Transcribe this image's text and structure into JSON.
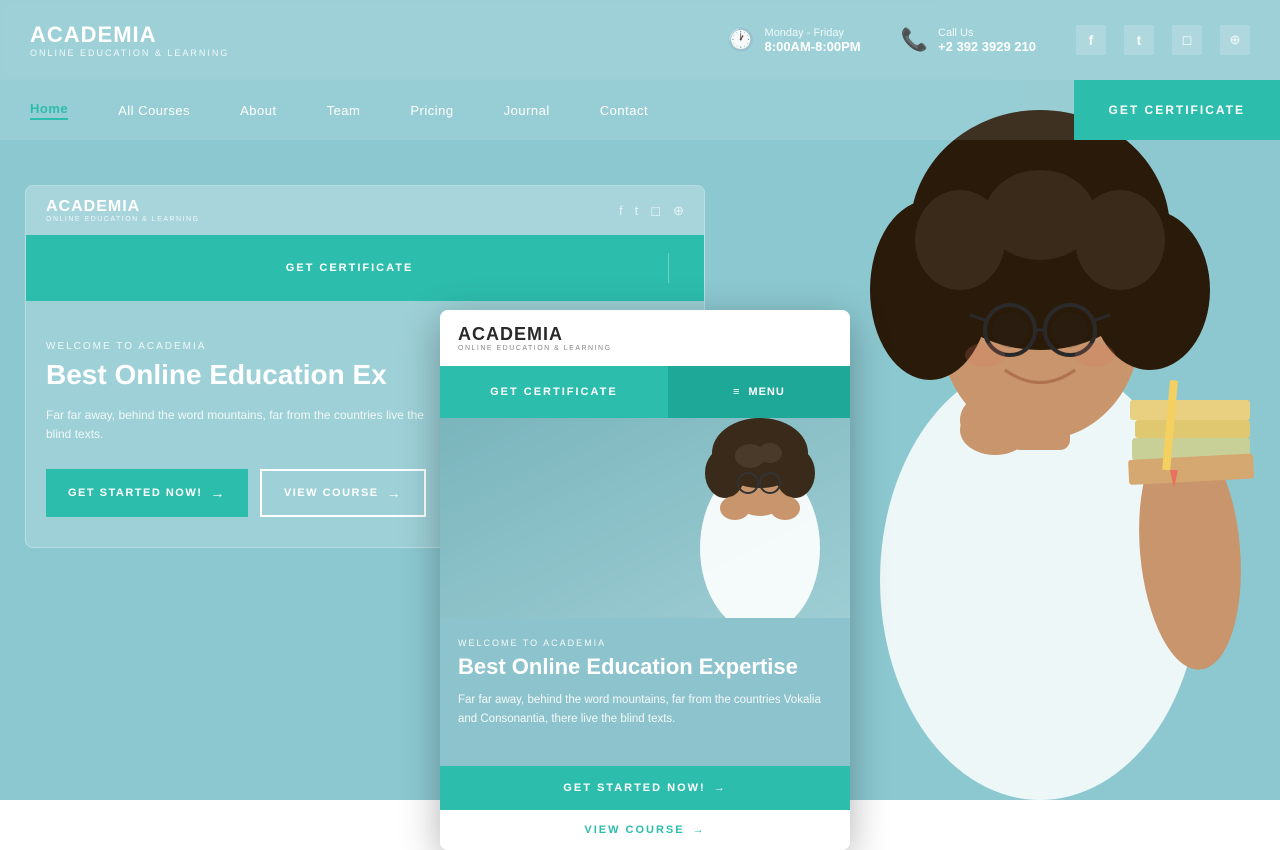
{
  "brand": {
    "name": "ACADEMIA",
    "tagline": "ONLINE EDUCATION & LEARNING"
  },
  "topbar": {
    "schedule_icon": "🕐",
    "schedule_label": "Monday - Friday",
    "schedule_value": "8:00AM-8:00PM",
    "phone_icon": "📞",
    "phone_label": "Call Us",
    "phone_value": "+2 392 3929 210"
  },
  "social": {
    "facebook": "f",
    "twitter": "t",
    "instagram": "in",
    "dribbble": "d"
  },
  "nav": {
    "links": [
      "Home",
      "All Courses",
      "About",
      "Team",
      "Pricing",
      "Journal",
      "Contact"
    ],
    "active": "Home",
    "cta": "GET CERTIFICATE"
  },
  "hero": {
    "welcome": "WELCOME TO ACADEMIA",
    "headline_line1": "Best Online Education Ex",
    "headline_full": "Best Online Education Expertise",
    "body": "Far far away, behind the word mountains, far from the countries Vokalia and Consonantia, there live the blind texts.",
    "body_short": "Far far away, behind the word mountains, far from the countries Vokalia and Consonantia, there live the blind texts.",
    "btn_primary": "GET STARTED NOW!",
    "btn_primary_arrow": "→",
    "btn_secondary": "VIEW COURSE",
    "btn_secondary_arrow": "→"
  },
  "desktop_preview": {
    "logo": "ACADEMIA",
    "tagline": "ONLINE EDUCATION & LEARNING",
    "cta": "GET CERTIFICATE",
    "welcome": "WELCOME TO ACADEMIA",
    "headline": "Best Online Education Ex",
    "body": "Far far away, behind the word mountains, far from the countries live the blind texts.",
    "btn_primary": "GET STARTED NOW!",
    "btn_primary_arrow": "→",
    "btn_secondary": "VIEW COURSE",
    "btn_secondary_arrow": "→"
  },
  "mobile_preview": {
    "logo": "ACADEMIA",
    "tagline": "ONLINE EDUCATION & LEARNING",
    "cta": "GET CERTIFICATE",
    "menu": "≡ MENU",
    "welcome": "WELCOME TO ACADEMIA",
    "headline": "Best Online Education Expertise",
    "body": "Far far away, behind the word mountains, far from the countries Vokalia and Consonantia, there live the blind texts.",
    "btn_primary": "GET STARTED NOW!",
    "btn_primary_arrow": "→",
    "btn_secondary": "VIEW COURSE",
    "btn_secondary_arrow": "→"
  },
  "colors": {
    "teal": "#2dbdad",
    "teal_dark": "#1ea898",
    "bg": "#8cc8d0",
    "white": "#ffffff",
    "text_dark": "#2a2a2a"
  }
}
